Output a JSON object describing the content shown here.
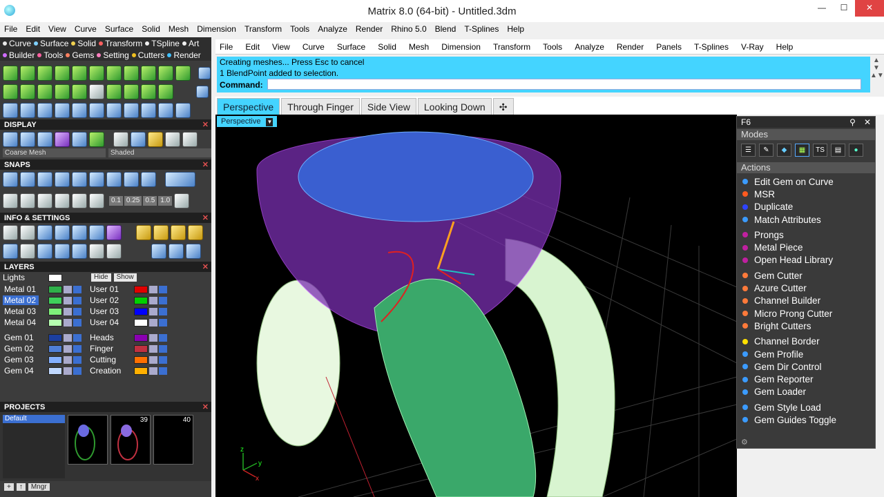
{
  "window": {
    "title": "Matrix 8.0 (64-bit) - Untitled.3dm",
    "btn_min": "—",
    "btn_max": "☐",
    "btn_close": "✕"
  },
  "menubar": {
    "items": [
      "File",
      "Edit",
      "View",
      "Curve",
      "Surface",
      "Solid",
      "Mesh",
      "Dimension",
      "Transform",
      "Tools",
      "Analyze",
      "Render",
      "Rhino 5.0",
      "Blend",
      "T-Splines",
      "Help"
    ]
  },
  "left_tabs": {
    "row1": [
      {
        "label": "Curve",
        "color": "#e8e8e8"
      },
      {
        "label": "Surface",
        "color": "#7fd0ff"
      },
      {
        "label": "Solid",
        "color": "#f0d050"
      },
      {
        "label": "Transform",
        "color": "#ff6060"
      },
      {
        "label": "TSpline",
        "color": "#f0f0f0"
      },
      {
        "label": "Art",
        "color": "#f0f0f0"
      }
    ],
    "row2": [
      {
        "label": "Builder",
        "color": "#d06cff"
      },
      {
        "label": "Tools",
        "color": "#ff60a0"
      },
      {
        "label": "Gems",
        "color": "#ff8060"
      },
      {
        "label": "Setting",
        "color": "#ff80c0"
      },
      {
        "label": "Cutters",
        "color": "#f0c020"
      },
      {
        "label": "Render",
        "color": "#40c0ff"
      }
    ]
  },
  "display": {
    "title": "DISPLAY",
    "mesh_select": "Coarse Mesh",
    "shade_select": "Shaded"
  },
  "snaps": {
    "title": "SNAPS",
    "values": [
      "0.1",
      "0.25",
      "0.5",
      "1.0"
    ]
  },
  "info": {
    "title": "INFO & SETTINGS"
  },
  "layers": {
    "title": "LAYERS",
    "lights": "Lights",
    "hide": "Hide",
    "show": "Show",
    "left": [
      {
        "name": "Metal 01",
        "color": "#2fb04a"
      },
      {
        "name": "Metal 02",
        "color": "#3ed15a"
      },
      {
        "name": "Metal 03",
        "color": "#7ef07a"
      },
      {
        "name": "Metal 04",
        "color": "#b6ffb0"
      },
      {
        "name": "Gem 01",
        "color": "#1c3fa0"
      },
      {
        "name": "Gem 02",
        "color": "#4f7fd8"
      },
      {
        "name": "Gem 03",
        "color": "#84b0ff"
      },
      {
        "name": "Gem 04",
        "color": "#c0d8ff"
      }
    ],
    "selected": "Metal 02",
    "right": [
      {
        "name": "User 01",
        "color": "#e00000"
      },
      {
        "name": "User 02",
        "color": "#00d000"
      },
      {
        "name": "User 03",
        "color": "#0000ff"
      },
      {
        "name": "User 04",
        "color": "#ffffff"
      },
      {
        "name": "Heads",
        "color": "#8a00b0"
      },
      {
        "name": "Finger",
        "color": "#c03040"
      },
      {
        "name": "Cutting",
        "color": "#ff7000"
      },
      {
        "name": "Creation",
        "color": "#ffb000"
      }
    ]
  },
  "projects": {
    "title": "PROJECTS",
    "default": "Default",
    "thumb2": "39",
    "thumb3": "40",
    "mngr": "Mngr"
  },
  "right_menu": {
    "items": [
      "File",
      "Edit",
      "View",
      "Curve",
      "Surface",
      "Solid",
      "Mesh",
      "Dimension",
      "Transform",
      "Tools",
      "Analyze",
      "Render",
      "Panels",
      "T-Splines",
      "V-Ray",
      "Help"
    ]
  },
  "command": {
    "line1": "Creating meshes... Press Esc to cancel",
    "line2": "1 BlendPoint added to selection.",
    "label": "Command:",
    "value": ""
  },
  "view_tabs": {
    "tabs": [
      "Perspective",
      "Through Finger",
      "Side View",
      "Looking Down"
    ],
    "active": "Perspective",
    "plus": "✣"
  },
  "viewport": {
    "label": "Perspective",
    "axis_z": "z",
    "axis_y": "y",
    "axis_x": "x"
  },
  "f6": {
    "title": "F6",
    "modes_label": "Modes",
    "actions_label": "Actions",
    "mode_icons": [
      "list-icon",
      "pencil-icon",
      "gem-icon",
      "grid-icon",
      "ts-icon",
      "page-icon",
      "sphere-icon"
    ],
    "ts_label": "TS",
    "actions": [
      {
        "label": "Edit Gem on Curve",
        "color": "#3b9bff"
      },
      {
        "label": "MSR",
        "color": "#ff5a1f"
      },
      {
        "label": "Duplicate",
        "color": "#2d43ff"
      },
      {
        "label": "Match Attributes",
        "color": "#3b9bff"
      },
      {
        "label": "Prongs",
        "color": "#c020a0"
      },
      {
        "label": "Metal Piece",
        "color": "#c020a0"
      },
      {
        "label": "Open Head Library",
        "color": "#c020a0"
      },
      {
        "label": "Gem Cutter",
        "color": "#ff7a3a"
      },
      {
        "label": "Azure Cutter",
        "color": "#ff7a3a"
      },
      {
        "label": "Channel Builder",
        "color": "#ff7a3a"
      },
      {
        "label": "Micro Prong Cutter",
        "color": "#ff7a3a"
      },
      {
        "label": "Bright Cutters",
        "color": "#ff7a3a"
      },
      {
        "label": "Channel Border",
        "color": "#ffe000"
      },
      {
        "label": "Gem Profile",
        "color": "#3b9bff"
      },
      {
        "label": "Gem Dir Control",
        "color": "#3b9bff"
      },
      {
        "label": "Gem Reporter",
        "color": "#3b9bff"
      },
      {
        "label": "Gem Loader",
        "color": "#3b9bff"
      },
      {
        "label": "Gem Style Load",
        "color": "#3b9bff"
      },
      {
        "label": "Gem Guides Toggle",
        "color": "#3b9bff"
      }
    ]
  }
}
